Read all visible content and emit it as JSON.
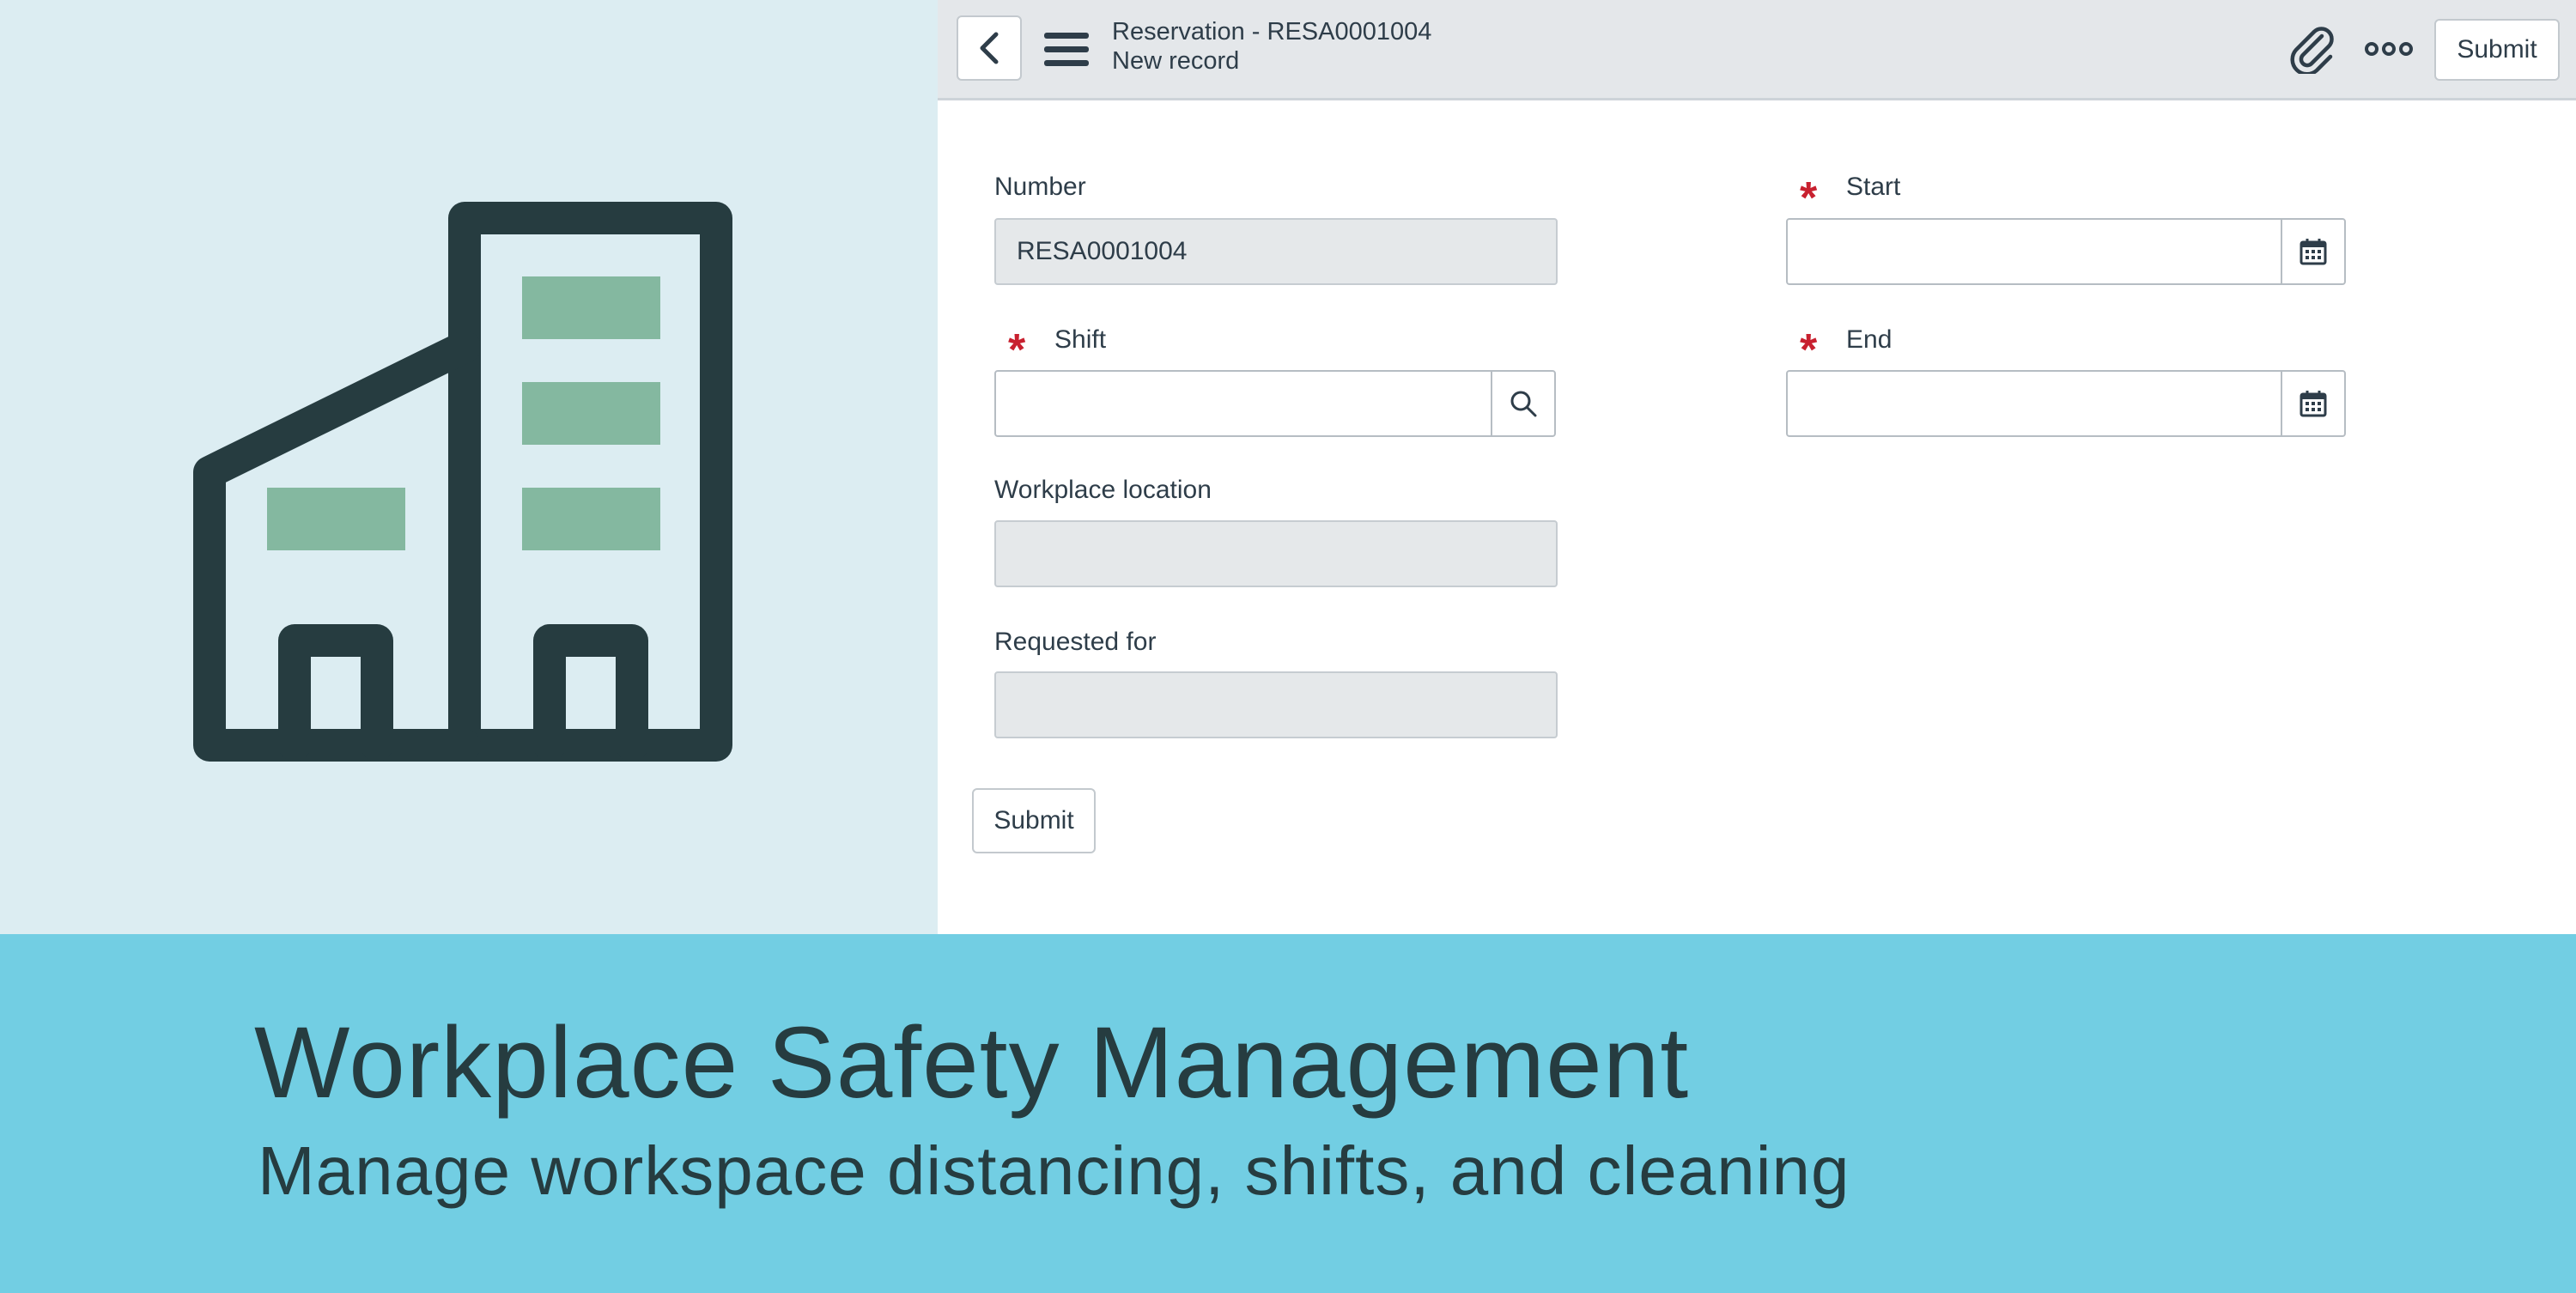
{
  "header": {
    "record_title": "Reservation - RESA0001004",
    "record_subtitle": "New record",
    "submit_label": "Submit",
    "icons": [
      "chevron-left-icon",
      "hamburger-menu-icon",
      "paperclip-icon",
      "more-options-icon"
    ]
  },
  "form": {
    "number": {
      "label": "Number",
      "value": "RESA0001004",
      "readonly": true
    },
    "shift": {
      "label": "Shift",
      "value": "",
      "required": true,
      "addon_icon": "search-icon"
    },
    "workplace_location": {
      "label": "Workplace location",
      "value": "",
      "readonly": true
    },
    "requested_for": {
      "label": "Requested for",
      "value": "",
      "readonly": true
    },
    "start": {
      "label": "Start",
      "value": "",
      "required": true,
      "addon_icon": "calendar-icon"
    },
    "end": {
      "label": "End",
      "value": "",
      "required": true,
      "addon_icon": "calendar-icon"
    },
    "required_marker": "*",
    "submit_label": "Submit"
  },
  "banner": {
    "title": "Workplace Safety Management",
    "subtitle": "Manage workspace distancing, shifts, and cleaning"
  },
  "colors": {
    "illustration_bg": "#dcedf2",
    "building_outline": "#263c40",
    "building_windows": "#84b8a0",
    "banner_bg": "#72cee3",
    "header_bg": "#e4e7ea",
    "required_star": "#c8202f"
  },
  "illustration": {
    "icon": "office-building-icon"
  }
}
